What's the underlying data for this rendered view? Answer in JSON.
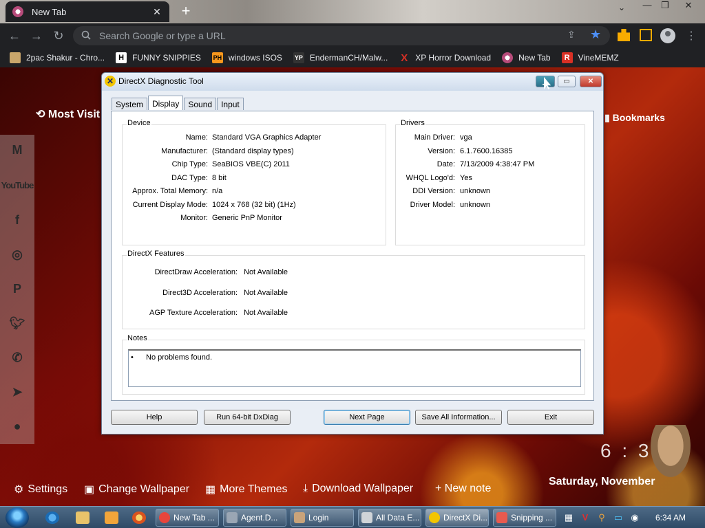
{
  "browser": {
    "tab_title": "New Tab",
    "omnibox_placeholder": "Search Google or type a URL",
    "bookmarks": [
      {
        "label": "2pac Shakur - Chro...",
        "icon": "2pac-favicon",
        "color": "#c9a66b"
      },
      {
        "label": "FUNNY SNIPPIES",
        "icon": "H",
        "color": "#ffffff"
      },
      {
        "label": "windows ISOS",
        "icon": "PH",
        "color": "#f7971d"
      },
      {
        "label": "EndermanCH/Malw...",
        "icon": "YP",
        "color": "#333333"
      },
      {
        "label": "XP Horror Download",
        "icon": "X",
        "color": "#d93025"
      },
      {
        "label": "New Tab",
        "icon": "newtab-favicon",
        "color": "#b74b7a"
      },
      {
        "label": "VineMEMZ",
        "icon": "R",
        "color": "#d93025"
      }
    ]
  },
  "ntp": {
    "most_visited": "Most Visit",
    "bookmarks_link": "Bookmarks",
    "clock": "6 : 34",
    "date": "Saturday, November",
    "bottom_links": [
      {
        "label": "Settings",
        "icon": "gear-icon"
      },
      {
        "label": "Change Wallpaper",
        "icon": "image-icon"
      },
      {
        "label": "More Themes",
        "icon": "grid-icon"
      },
      {
        "label": "Download Wallpaper",
        "icon": "download-icon"
      },
      {
        "label": "+ New note",
        "icon": "plus-icon"
      }
    ],
    "social": [
      "gmail-icon",
      "youtube-icon",
      "facebook-icon",
      "instagram-icon",
      "pinterest-icon",
      "twitter-icon",
      "whatsapp-icon",
      "telegram-icon",
      "reddit-icon"
    ],
    "youtube_label": "YouTube"
  },
  "dialog": {
    "title": "DirectX Diagnostic Tool",
    "tabs": [
      "System",
      "Display",
      "Sound",
      "Input"
    ],
    "active_tab": "Display",
    "device": {
      "title": "Device",
      "rows": [
        {
          "label": "Name:",
          "value": "Standard VGA Graphics Adapter"
        },
        {
          "label": "Manufacturer:",
          "value": "(Standard display types)"
        },
        {
          "label": "Chip Type:",
          "value": "SeaBIOS VBE(C) 2011"
        },
        {
          "label": "DAC Type:",
          "value": "8 bit"
        },
        {
          "label": "Approx. Total Memory:",
          "value": "n/a"
        },
        {
          "label": "Current Display Mode:",
          "value": "1024 x 768 (32 bit) (1Hz)"
        },
        {
          "label": "Monitor:",
          "value": "Generic PnP Monitor"
        }
      ]
    },
    "drivers": {
      "title": "Drivers",
      "rows": [
        {
          "label": "Main Driver:",
          "value": "vga"
        },
        {
          "label": "Version:",
          "value": "6.1.7600.16385"
        },
        {
          "label": "Date:",
          "value": "7/13/2009 4:38:47 PM"
        },
        {
          "label": "WHQL Logo'd:",
          "value": "Yes"
        },
        {
          "label": "DDI Version:",
          "value": "unknown"
        },
        {
          "label": "Driver Model:",
          "value": "unknown"
        }
      ]
    },
    "features": {
      "title": "DirectX Features",
      "rows": [
        {
          "label": "DirectDraw Acceleration:",
          "value": "Not Available"
        },
        {
          "label": "Direct3D Acceleration:",
          "value": "Not Available"
        },
        {
          "label": "AGP Texture Acceleration:",
          "value": "Not Available"
        }
      ]
    },
    "notes": {
      "title": "Notes",
      "bullet": "•",
      "items": [
        "No problems found."
      ]
    },
    "buttons": {
      "help": "Help",
      "run64": "Run 64-bit DxDiag",
      "next": "Next Page",
      "save": "Save All Information...",
      "exit": "Exit"
    }
  },
  "taskbar": {
    "items": [
      {
        "label": "New Tab ...",
        "icon": "chrome-icon",
        "color": "#e8453c"
      },
      {
        "label": "Agent.D...",
        "icon": "agent-icon",
        "color": "#9aa6b4"
      },
      {
        "label": "Login",
        "icon": "login-icon",
        "color": "#c9a37a"
      },
      {
        "label": "All Data E...",
        "icon": "data-icon",
        "color": "#d0d4d8"
      },
      {
        "label": "DirectX Di...",
        "icon": "directx-icon",
        "color": "#f2c500"
      },
      {
        "label": "Snipping ...",
        "icon": "snipping-icon",
        "color": "#e85a4f"
      }
    ],
    "active_index": 4,
    "clock": "6:34 AM"
  }
}
